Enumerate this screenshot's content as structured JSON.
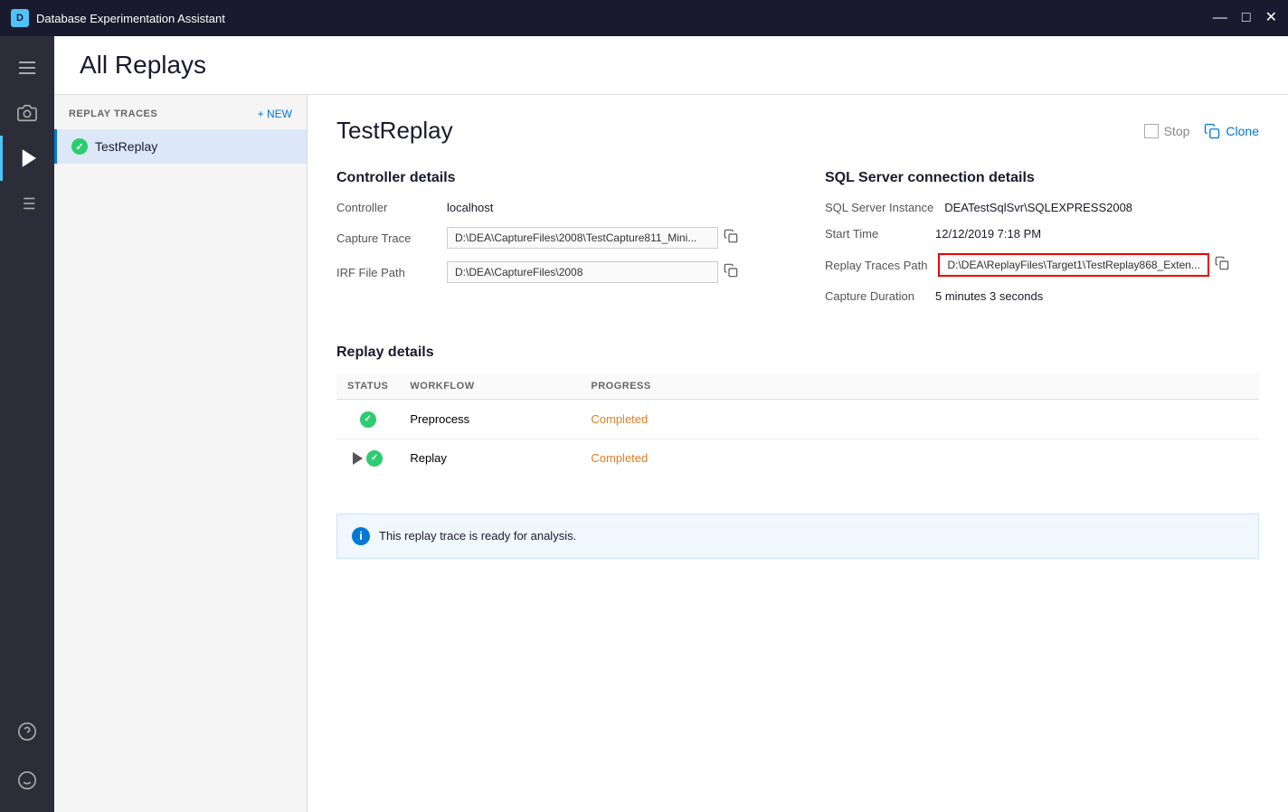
{
  "titleBar": {
    "appName": "Database Experimentation Assistant",
    "iconText": "D",
    "minimizeIcon": "—",
    "maximizeIcon": "□",
    "closeIcon": "✕"
  },
  "pageHeader": {
    "title": "All Replays"
  },
  "sidebar": {
    "icons": [
      {
        "name": "hamburger",
        "label": "Menu"
      },
      {
        "name": "camera",
        "label": "Capture"
      },
      {
        "name": "replay",
        "label": "Replay",
        "active": true
      },
      {
        "name": "analysis",
        "label": "Analysis"
      }
    ],
    "bottomIcons": [
      {
        "name": "help",
        "label": "Help"
      },
      {
        "name": "face",
        "label": "Feedback"
      }
    ]
  },
  "leftPanel": {
    "sectionLabel": "REPLAY TRACES",
    "newButtonLabel": "+ NEW",
    "items": [
      {
        "name": "TestReplay",
        "active": true
      }
    ]
  },
  "mainContent": {
    "title": "TestReplay",
    "stopButtonLabel": "Stop",
    "cloneButtonLabel": "Clone",
    "controllerDetails": {
      "heading": "Controller details",
      "fields": [
        {
          "label": "Controller",
          "value": "localhost",
          "isInput": false
        },
        {
          "label": "Capture Trace",
          "value": "D:\\DEA\\CaptureFiles\\2008\\TestCapture811_Mini...",
          "isInput": true
        },
        {
          "label": "IRF File Path",
          "value": "D:\\DEA\\CaptureFiles\\2008",
          "isInput": true
        }
      ]
    },
    "sqlServerDetails": {
      "heading": "SQL Server connection details",
      "fields": [
        {
          "label": "SQL Server Instance",
          "value": "DEATestSqlSvr\\SQLEXPRESS2008",
          "isInput": false
        },
        {
          "label": "Start Time",
          "value": "12/12/2019 7:18 PM",
          "isInput": false
        },
        {
          "label": "Replay Traces Path",
          "value": "D:\\DEA\\ReplayFiles\\Target1\\TestReplay868_Exten...",
          "isInput": true,
          "highlighted": true
        },
        {
          "label": "Capture Duration",
          "value": "5 minutes 3 seconds",
          "isInput": false
        }
      ]
    },
    "replayDetails": {
      "heading": "Replay details",
      "columns": [
        "STATUS",
        "WORKFLOW",
        "PROGRESS"
      ],
      "rows": [
        {
          "status": "check",
          "hasPlay": false,
          "workflow": "Preprocess",
          "progress": "Completed"
        },
        {
          "status": "check",
          "hasPlay": true,
          "workflow": "Replay",
          "progress": "Completed"
        }
      ]
    },
    "infoBanner": {
      "message": "This replay trace is ready for analysis."
    }
  }
}
